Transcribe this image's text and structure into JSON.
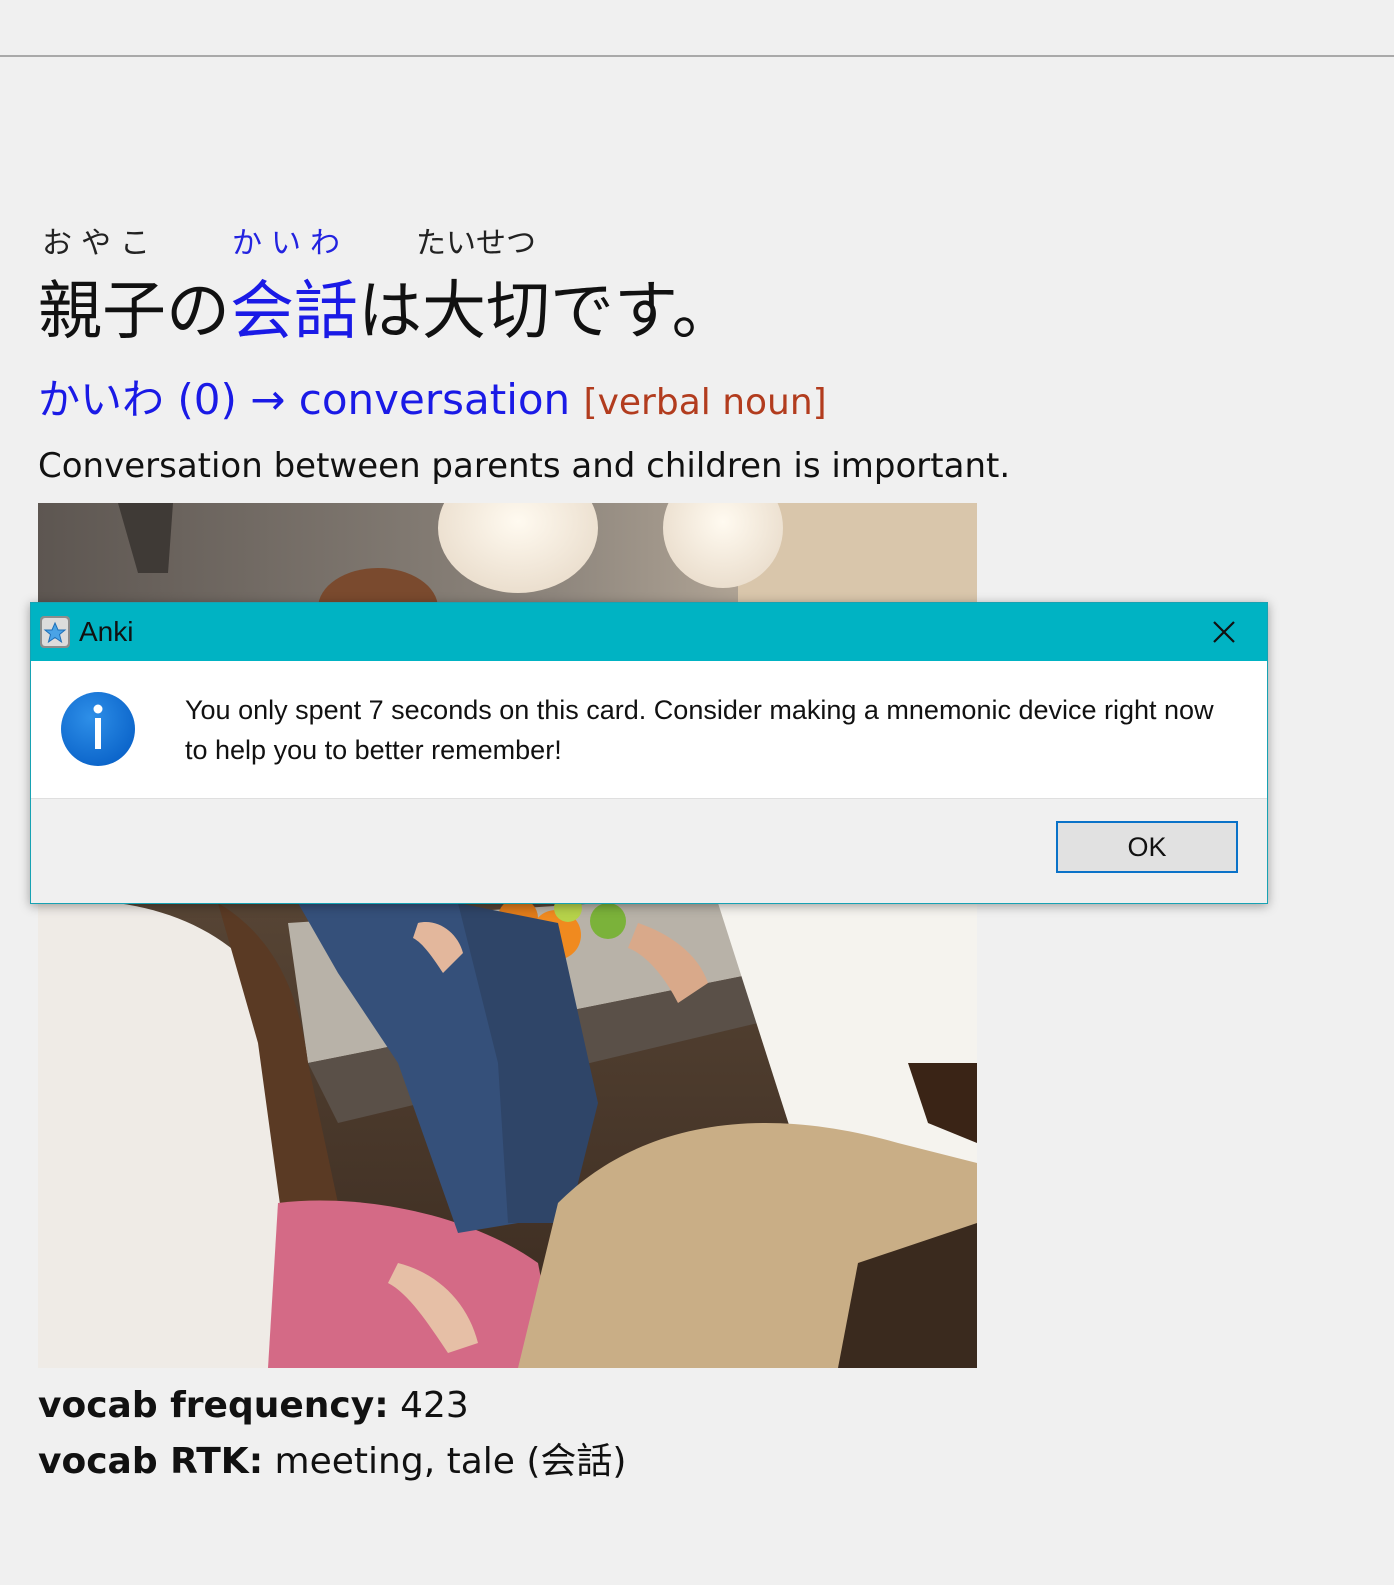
{
  "card": {
    "furigana": {
      "oyako": "おやこ",
      "kaiwa": "かいわ",
      "taisetsu": "たいせつ"
    },
    "sentence": {
      "prefix": "親子の",
      "target": "会話",
      "suffix": "は大切です。"
    },
    "definition": {
      "main": "かいわ (0) → conversation",
      "part_of_speech": "[verbal noun]"
    },
    "translation": "Conversation between parents and children is important.",
    "vocab_frequency": {
      "label": "vocab frequency:",
      "value": "423"
    },
    "vocab_rtk": {
      "label": "vocab RTK:",
      "value": "meeting, tale (会話)"
    }
  },
  "dialog": {
    "title": "Anki",
    "message": "You only spent 7 seconds on this card. Consider making a mnemonic device right now to help you to better remember!",
    "ok_label": "OK",
    "icon": "info-icon",
    "titlebar_color": "#00b3c3"
  },
  "colors": {
    "target_word": "#1a1ae6",
    "part_of_speech": "#b23c1e",
    "page_background": "#f0f0f0"
  }
}
